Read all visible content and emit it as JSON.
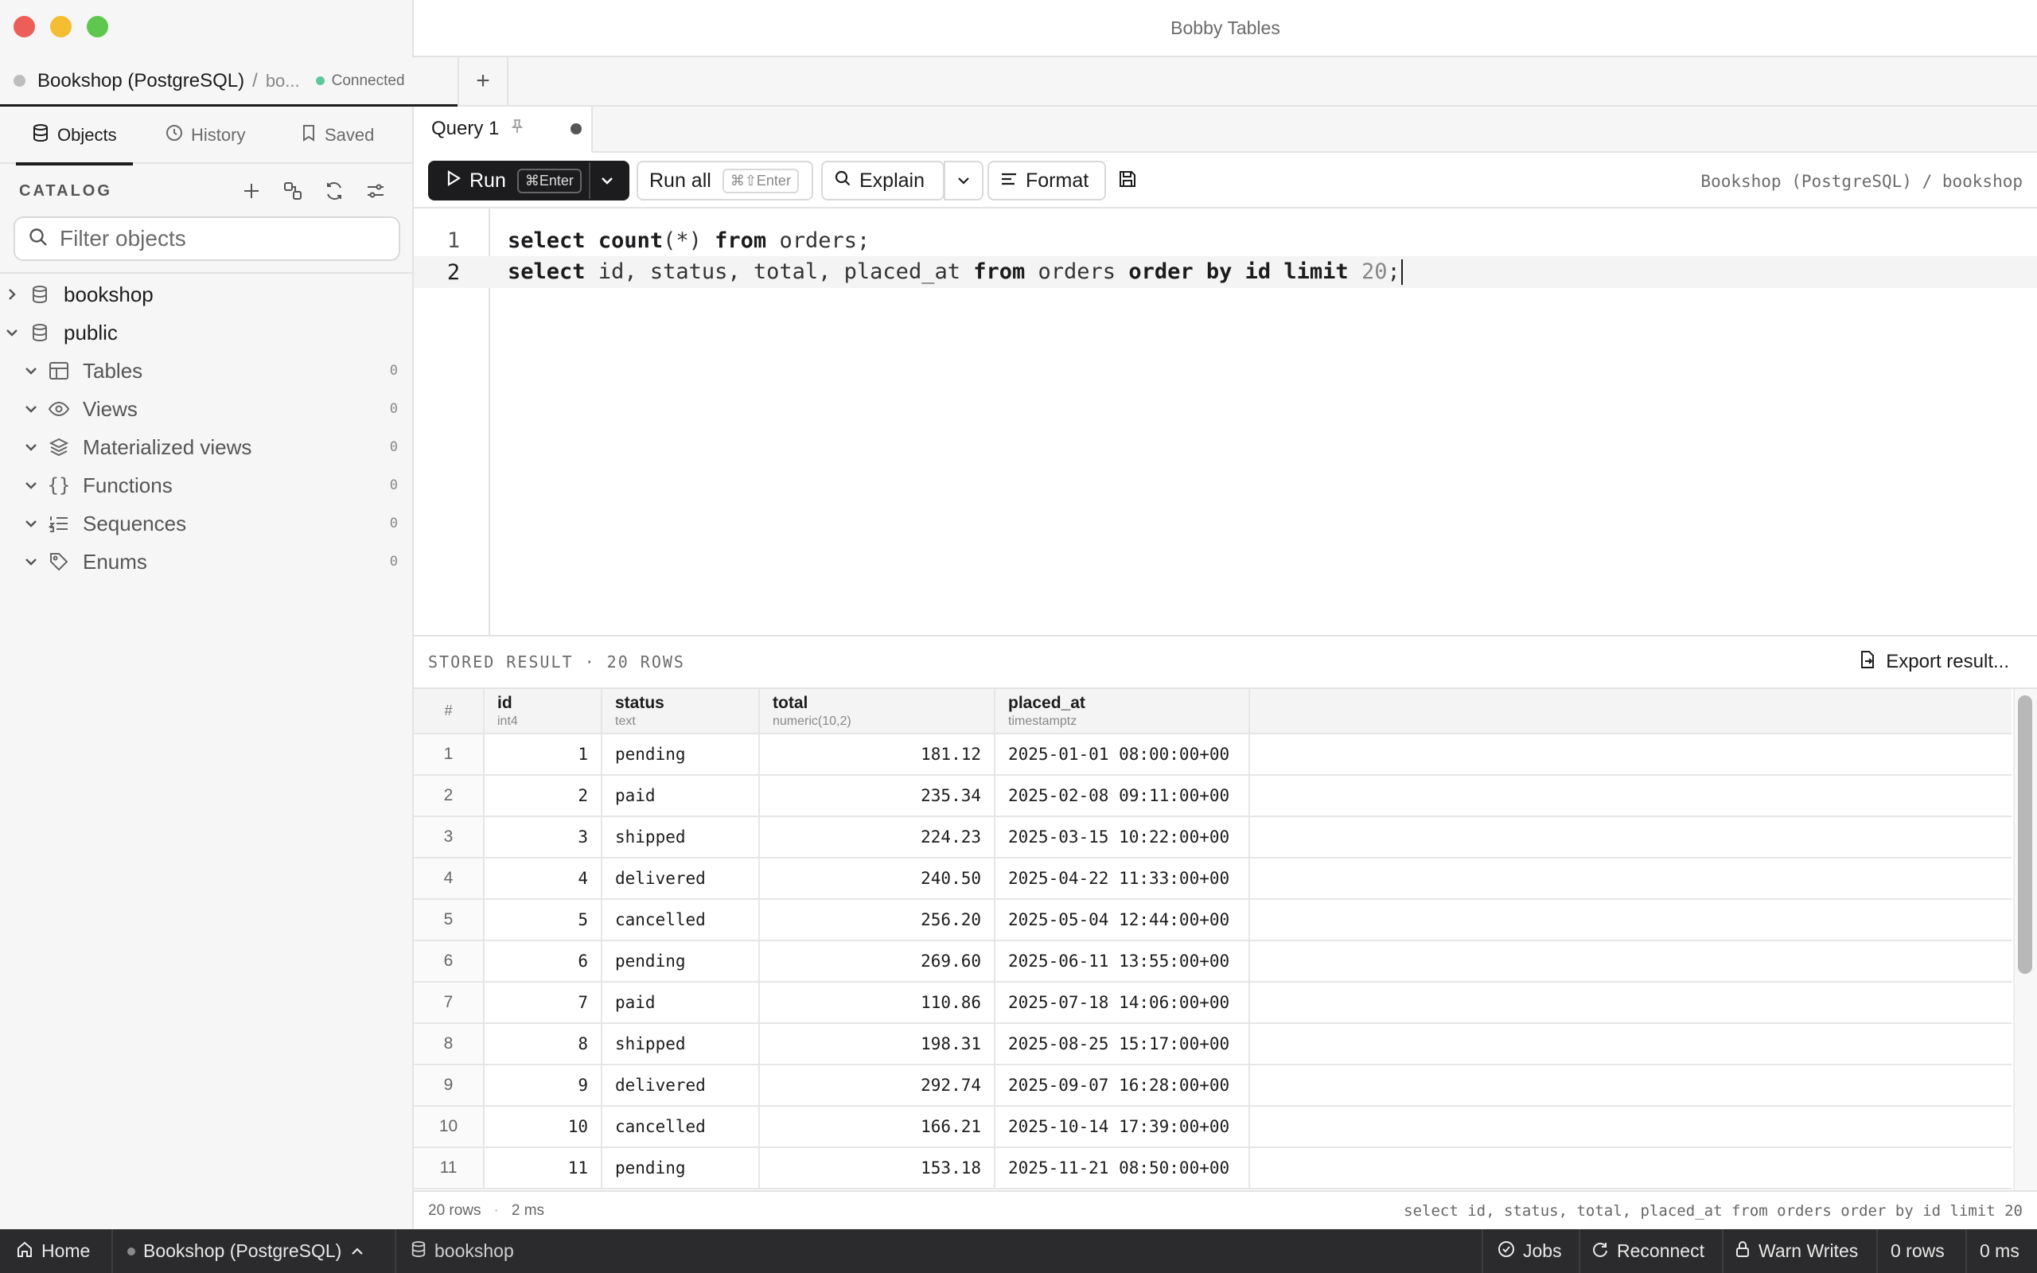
{
  "window": {
    "title": "Bobby Tables"
  },
  "colors": {
    "close": "#ec5f58",
    "minimize": "#f5bd31",
    "maximize": "#5fc74d",
    "connected": "#5fc79c",
    "accent": "#1c1c1e"
  },
  "connection_tab": {
    "name": "Bookshop (PostgreSQL)",
    "separator": "/",
    "database": "bo...",
    "status": "Connected"
  },
  "sidebar": {
    "tabs": [
      {
        "label": "Objects",
        "icon": "database-icon"
      },
      {
        "label": "History",
        "icon": "clock-icon"
      },
      {
        "label": "Saved",
        "icon": "bookmark-icon"
      }
    ],
    "catalog_title": "CATALOG",
    "filter_placeholder": "Filter objects",
    "databases": [
      {
        "label": "bookshop",
        "expanded": false
      },
      {
        "label": "public",
        "expanded": true
      }
    ],
    "groups": [
      {
        "label": "Tables",
        "count": "0",
        "icon": "table-icon"
      },
      {
        "label": "Views",
        "count": "0",
        "icon": "eye-icon"
      },
      {
        "label": "Materialized views",
        "count": "0",
        "icon": "layers-icon"
      },
      {
        "label": "Functions",
        "count": "0",
        "icon": "braces-icon"
      },
      {
        "label": "Sequences",
        "count": "0",
        "icon": "list-ordered-icon"
      },
      {
        "label": "Enums",
        "count": "0",
        "icon": "tag-icon"
      }
    ]
  },
  "query_tab": {
    "label": "Query 1"
  },
  "toolbar": {
    "run_label": "Run",
    "run_shortcut": "⌘Enter",
    "run_all_label": "Run all",
    "run_all_shortcut": "⌘⇧Enter",
    "explain_label": "Explain",
    "format_label": "Format",
    "connection_path": "Bookshop (PostgreSQL) / bookshop"
  },
  "editor": {
    "line_numbers": [
      "1",
      "2"
    ],
    "line1": {
      "kw1": "select",
      "fn": "count",
      "args": "(*)",
      "kw2": "from",
      "table": "orders;"
    },
    "line2": {
      "kw1": "select",
      "cols": "id, status, total, placed_at",
      "kw2": "from",
      "table": "orders",
      "kw3": "order by id limit",
      "num": "20",
      "end": ";"
    }
  },
  "results": {
    "title": "STORED RESULT · 20 ROWS",
    "export_label": "Export result...",
    "columns": [
      {
        "name": "#",
        "type": ""
      },
      {
        "name": "id",
        "type": "int4"
      },
      {
        "name": "status",
        "type": "text"
      },
      {
        "name": "total",
        "type": "numeric(10,2)"
      },
      {
        "name": "placed_at",
        "type": "timestamptz"
      }
    ],
    "rows": [
      [
        "1",
        "1",
        "pending",
        "181.12",
        "2025-01-01 08:00:00+00"
      ],
      [
        "2",
        "2",
        "paid",
        "235.34",
        "2025-02-08 09:11:00+00"
      ],
      [
        "3",
        "3",
        "shipped",
        "224.23",
        "2025-03-15 10:22:00+00"
      ],
      [
        "4",
        "4",
        "delivered",
        "240.50",
        "2025-04-22 11:33:00+00"
      ],
      [
        "5",
        "5",
        "cancelled",
        "256.20",
        "2025-05-04 12:44:00+00"
      ],
      [
        "6",
        "6",
        "pending",
        "269.60",
        "2025-06-11 13:55:00+00"
      ],
      [
        "7",
        "7",
        "paid",
        "110.86",
        "2025-07-18 14:06:00+00"
      ],
      [
        "8",
        "8",
        "shipped",
        "198.31",
        "2025-08-25 15:17:00+00"
      ],
      [
        "9",
        "9",
        "delivered",
        "292.74",
        "2025-09-07 16:28:00+00"
      ],
      [
        "10",
        "10",
        "cancelled",
        "166.21",
        "2025-10-14 17:39:00+00"
      ],
      [
        "11",
        "11",
        "pending",
        "153.18",
        "2025-11-21 08:50:00+00"
      ]
    ],
    "footer": {
      "rows": "20 rows",
      "dot": "·",
      "time": "2 ms",
      "query": "select id, status, total, placed_at from orders order by id limit 20"
    }
  },
  "statusbar": {
    "home": "Home",
    "connection": "Bookshop (PostgreSQL)",
    "database": "bookshop",
    "jobs": "Jobs",
    "reconnect": "Reconnect",
    "warn_writes": "Warn Writes",
    "rows": "0 rows",
    "time": "0 ms"
  }
}
